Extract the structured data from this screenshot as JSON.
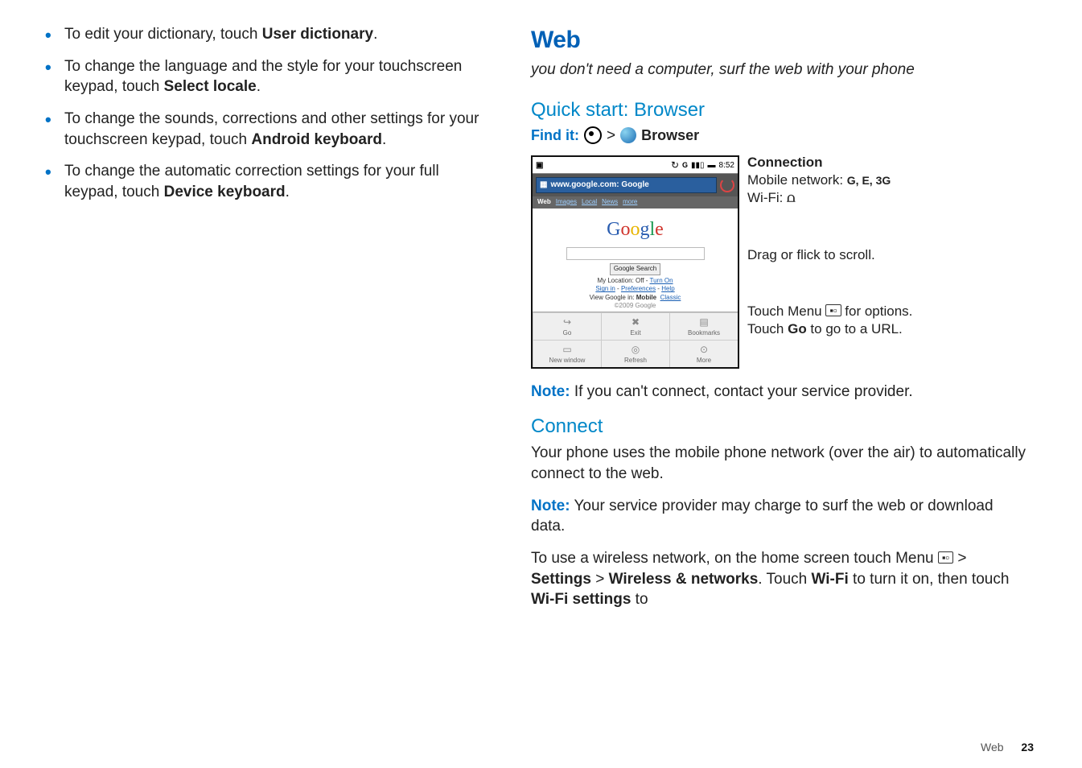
{
  "left": {
    "b1_pre": "To edit your dictionary, touch ",
    "b1_bold": "User dictionary",
    "b1_post": ".",
    "b2_pre": "To change the language and the style for your touchscreen keypad, touch ",
    "b2_bold": "Select locale",
    "b2_post": ".",
    "b3_pre": "To change the sounds, corrections and other settings for your touchscreen keypad, touch ",
    "b3_bold": "Android keyboard",
    "b3_post": ".",
    "b4_pre": "To change the automatic correction settings for your full keypad, touch ",
    "b4_bold": "Device keyboard",
    "b4_post": "."
  },
  "right": {
    "title": "Web",
    "tagline": "you don't need a computer, surf the web with your phone",
    "quick": "Quick start: Browser",
    "findit": "Find it:",
    "gt": ">",
    "browser": "Browser",
    "statusbar_time": "8:52",
    "titlebar_text": "www.google.com: Google",
    "nav_web": "Web",
    "nav_images": "Images",
    "nav_local": "Local",
    "nav_news": "News",
    "nav_more": "more",
    "gsearch_btn": "Google Search",
    "loc_off": "My Location: Off - ",
    "turn_on": "Turn On",
    "signin": "Sign in",
    "prefs": "Preferences",
    "help": "Help",
    "view_mobile": "View Google in: ",
    "mobile_bold": "Mobile",
    "classic": "Classic",
    "copyright": "©2009 Google",
    "menu_go": "Go",
    "menu_exit": "Exit",
    "menu_bookmarks": "Bookmarks",
    "menu_newwin": "New window",
    "menu_refresh": "Refresh",
    "menu_more": "More",
    "call_conn_title": "Connection",
    "call_conn_mobile": "Mobile network:",
    "call_conn_net": "G, E, 3G",
    "call_conn_wifi": "Wi-Fi: ",
    "wifi_glyph": "⌢",
    "call_drag": "Drag or flick to scroll.",
    "call_menu_pre": "Touch Menu ",
    "call_menu_post": " for options.",
    "call_go_pre": "Touch ",
    "call_go_bold": "Go",
    "call_go_post": " to go to a URL.",
    "note1_label": "Note:",
    "note1_text": " If you can't connect, contact your service provider.",
    "connect_h": "Connect",
    "connect_p1": "Your phone uses the mobile phone network (over the air) to automatically connect to the web.",
    "note2_label": "Note:",
    "note2_text": " Your service provider may charge to surf the web or download data.",
    "wifi_p_pre": "To use a wireless network, on the home screen touch Menu ",
    "wifi_p_gt": " > ",
    "wifi_settings_bold": "Settings",
    "wifi_wireless_bold": "Wireless & networks",
    "wifi_p_dot": ". Touch ",
    "wifi_wifi_bold": "Wi-Fi",
    "wifi_turn": " to turn it on, then touch ",
    "wifi_wifi_settings_bold": "Wi-Fi settings",
    "wifi_to": " to",
    "menu_icon_glyph": "▪▫",
    "footer_label": "Web",
    "footer_page": "23"
  }
}
